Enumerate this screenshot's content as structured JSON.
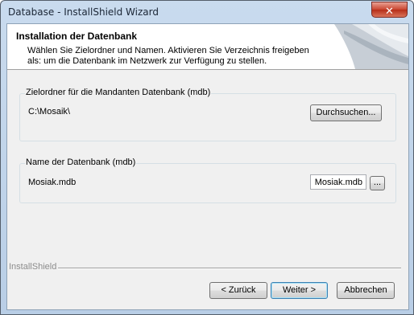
{
  "window": {
    "title": "Database - InstallShield Wizard",
    "close_glyph": "✕"
  },
  "header": {
    "title": "Installation der Datenbank",
    "subtitle": "Wählen Sie Zielordner und Namen. Aktivieren Sie Verzeichnis freigeben als: um die Datenbank im Netzwerk zur Verfügung zu stellen."
  },
  "target_group": {
    "label": "Zielordner für die Mandanten Datenbank (mdb)",
    "path": "C:\\Mosaik\\",
    "browse_label": "Durchsuchen..."
  },
  "name_group": {
    "label": "Name der Datenbank (mdb)",
    "value_label": "Mosiak.mdb",
    "input_value": "Mosiak.mdb",
    "browse_label": "..."
  },
  "footer": {
    "brand": "InstallShield",
    "back_label": "< Zurück",
    "next_label": "Weiter >",
    "cancel_label": "Abbrechen"
  },
  "colors": {
    "title_bar": "#c9dbee",
    "close_button": "#c9452f",
    "dialog_bg": "#f0f0f0",
    "default_button_border": "#3c7fb1"
  }
}
